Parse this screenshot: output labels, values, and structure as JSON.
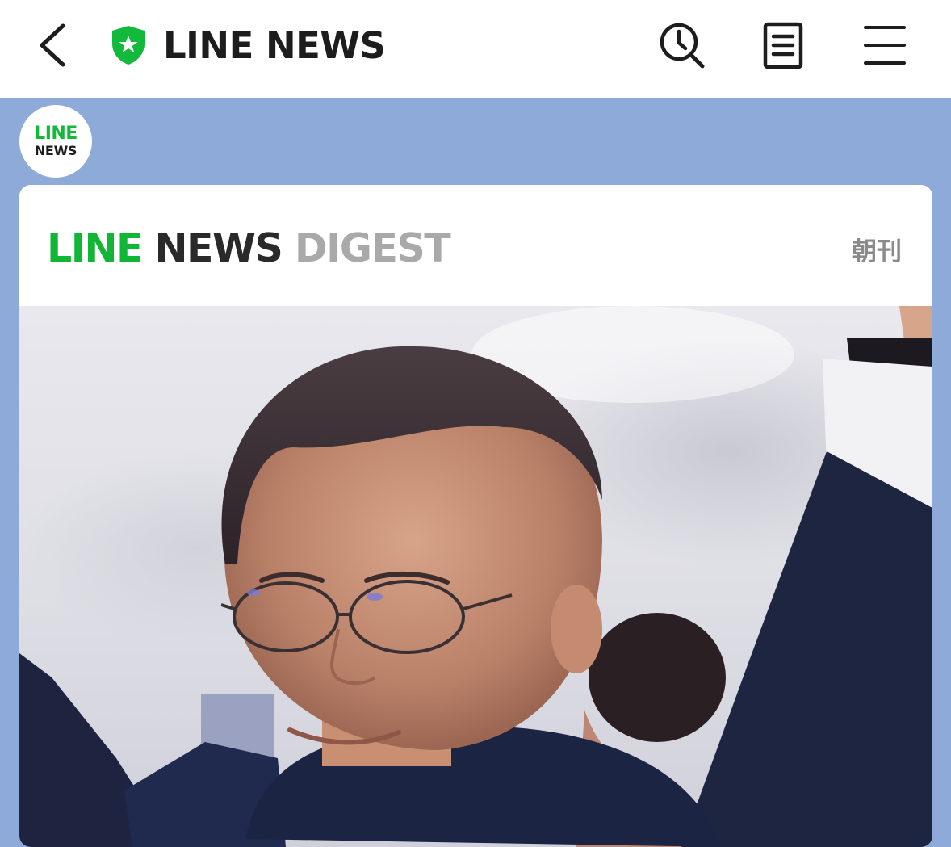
{
  "header": {
    "title": "LINE NEWS",
    "back_icon": "chevron-left-icon",
    "brand_icon": "shield-star-icon",
    "history_icon": "history-search-icon",
    "doc_icon": "document-icon",
    "menu_icon": "hamburger-menu-icon"
  },
  "account": {
    "avatar_line1": "LINE",
    "avatar_line2": "NEWS"
  },
  "digest": {
    "logo_part1": "LINE",
    "logo_part2": "NEWS",
    "logo_part3": "DIGEST",
    "edition": "朝刊"
  },
  "colors": {
    "background": "#8eaad8",
    "brand_green": "#12b636",
    "dark_text": "#1d1d1d",
    "gray_text": "#a9a9a9"
  }
}
